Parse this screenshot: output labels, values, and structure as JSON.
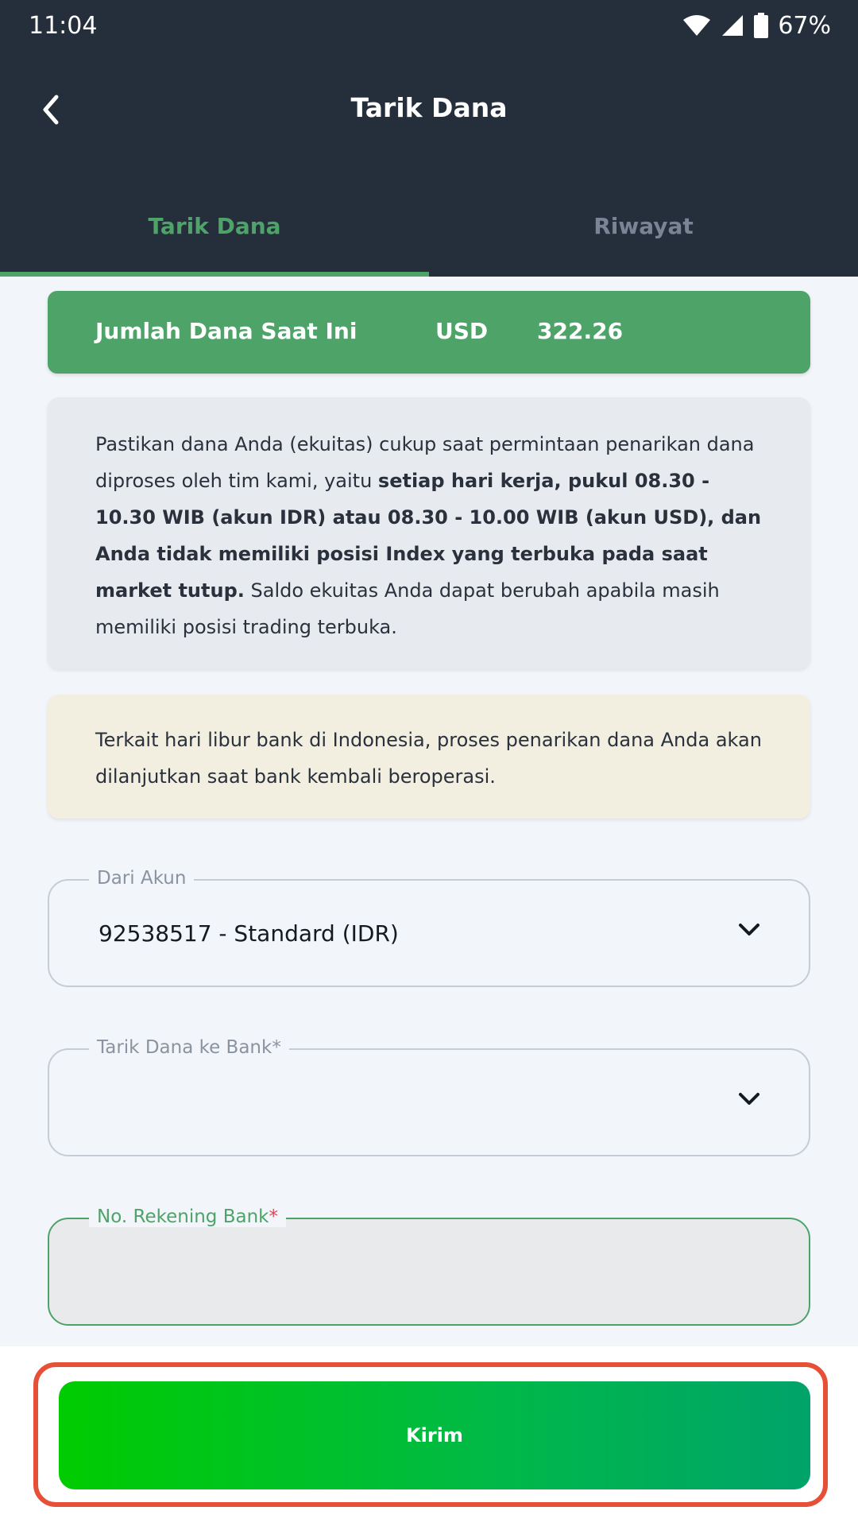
{
  "status_bar": {
    "time": "11:04",
    "battery": "67%"
  },
  "header": {
    "title": "Tarik Dana"
  },
  "tabs": [
    {
      "label": "Tarik Dana",
      "active": true
    },
    {
      "label": "Riwayat",
      "active": false
    }
  ],
  "balance": {
    "label": "Jumlah Dana Saat Ini",
    "currency": "USD",
    "amount": "322.26"
  },
  "info": {
    "p1": "Pastikan dana Anda (ekuitas) cukup saat permintaan penarikan dana diproses oleh tim kami, yaitu ",
    "bold": "setiap hari kerja, pukul 08.30 - 10.30 WIB (akun IDR) atau 08.30 - 10.00 WIB (akun USD), dan Anda tidak memiliki posisi Index yang terbuka pada saat market tutup.",
    "p2": " Saldo ekuitas Anda dapat berubah apabila masih memiliki posisi trading terbuka."
  },
  "notice": {
    "text": "Terkait hari libur bank di Indonesia, proses penarikan dana Anda akan dilanjutkan saat bank kembali beroperasi."
  },
  "form": {
    "from_account": {
      "label": "Dari Akun",
      "value": "92538517 - Standard (IDR)"
    },
    "bank": {
      "label": "Tarik Dana ke Bank*",
      "value": ""
    },
    "account_number": {
      "label": "No. Rekening Bank",
      "required_mark": "*",
      "value": ""
    }
  },
  "submit": {
    "label": "Kirim"
  },
  "colors": {
    "header_bg": "#252e3b",
    "accent": "#4ea369",
    "highlight": "#e55037"
  }
}
